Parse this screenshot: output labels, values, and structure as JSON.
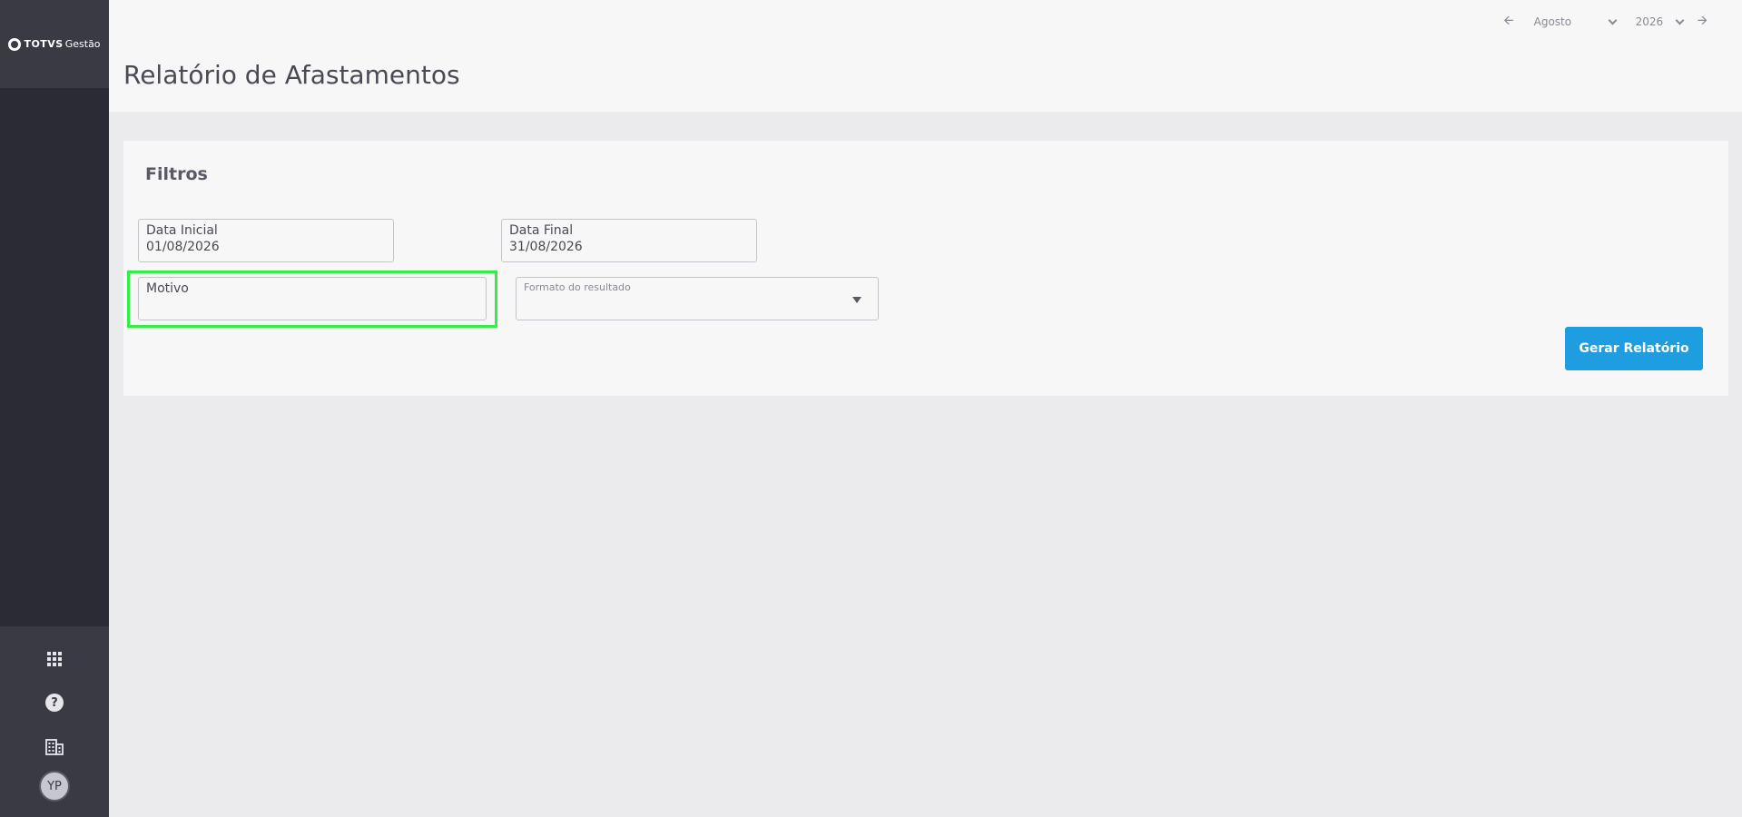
{
  "brand": {
    "name_bold": "TOTVS",
    "name_light": "Gestão"
  },
  "header": {
    "title": "Relatório de Afastamentos",
    "period": {
      "month": "Agosto",
      "year": "2026"
    }
  },
  "filters": {
    "title": "Filtros",
    "start_date": {
      "label": "Data Inicial",
      "value": "01/08/2026"
    },
    "end_date": {
      "label": "Data Final",
      "value": "31/08/2026"
    },
    "reason": {
      "label": "Motivo",
      "value": ""
    },
    "format": {
      "label": "Formato do resultado",
      "value": ""
    },
    "submit_label": "Gerar Relatório"
  },
  "user": {
    "initials": "YP"
  },
  "colors": {
    "sidebar": "#2b2b36",
    "primary": "#1e9ee0",
    "highlight": "#33ee44"
  },
  "icons": [
    "arrow-left-icon",
    "chevron-down-icon",
    "arrow-right-icon",
    "apps-grid-icon",
    "help-icon",
    "building-icon",
    "caret-down-icon"
  ]
}
